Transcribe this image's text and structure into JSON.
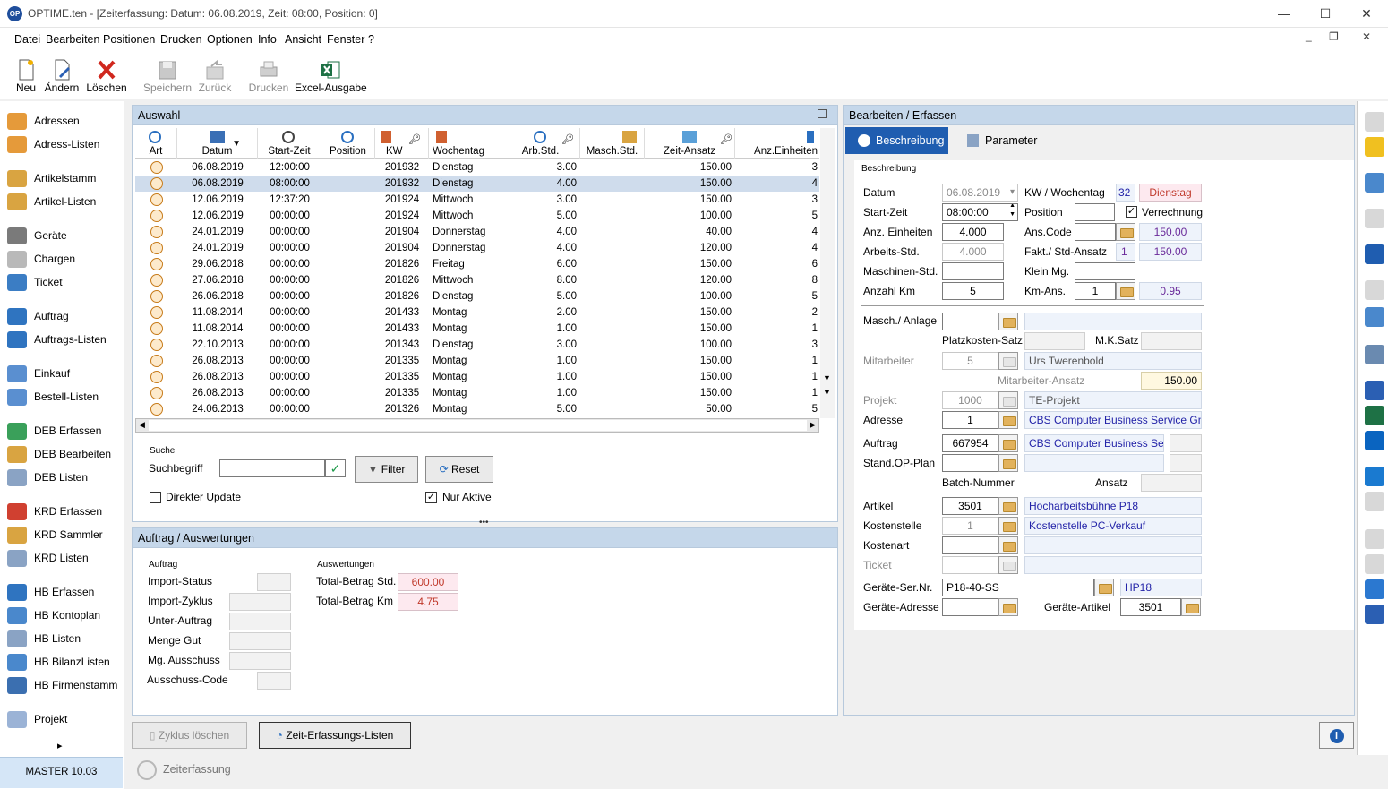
{
  "titlebar": {
    "app": "OPTIME.ten",
    "title": "- [Zeiterfassung: Datum: 06.08.2019, Zeit: 08:00, Position: 0]",
    "logo": "OP",
    "minimize_icon": "—",
    "maximize_icon": "☐",
    "close_icon": "✕",
    "mdi_minimize": "_",
    "mdi_restore": "❐",
    "mdi_close": "✕"
  },
  "menu": [
    "Datei",
    "Bearbeiten",
    "Positionen",
    "Drucken",
    "Optionen",
    "Info",
    "Ansicht",
    "Fenster",
    "?"
  ],
  "toolbar": {
    "new": "Neu",
    "edit": "Ändern",
    "delete": "Löschen",
    "save": "Speichern",
    "back": "Zurück",
    "print": "Drucken",
    "excel": "Excel-Ausgabe"
  },
  "sidebar": {
    "items": [
      "Adressen",
      "Adress-Listen",
      "Artikelstamm",
      "Artikel-Listen",
      "Geräte",
      "Chargen",
      "Ticket",
      "Auftrag",
      "Auftrags-Listen",
      "Einkauf",
      "Bestell-Listen",
      "DEB Erfassen",
      "DEB Bearbeiten",
      "DEB Listen",
      "KRD Erfassen",
      "KRD Sammler",
      "KRD Listen",
      "HB Erfassen",
      "HB Kontoplan",
      "HB Listen",
      "HB BilanzListen",
      "HB Firmenstamm",
      "Projekt"
    ],
    "expand_arrow": "▸",
    "master": "MASTER   10.03"
  },
  "auswahl": {
    "title": "Auswahl",
    "columns": [
      "Art",
      "Datum",
      "Start-Zeit",
      "Position",
      "KW",
      "Wochentag",
      "Arb.Std.",
      "Masch.Std.",
      "Zeit-Ansatz",
      "Anz.Einheiten"
    ],
    "rows": [
      {
        "datum": "06.08.2019",
        "start": "12:00:00",
        "pos": "",
        "kw": "201932",
        "tag": "Dienstag",
        "arb": "3.00",
        "masch": "",
        "ansatz": "150.00",
        "anz": "3"
      },
      {
        "datum": "06.08.2019",
        "start": "08:00:00",
        "pos": "",
        "kw": "201932",
        "tag": "Dienstag",
        "arb": "4.00",
        "masch": "",
        "ansatz": "150.00",
        "anz": "4"
      },
      {
        "datum": "12.06.2019",
        "start": "12:37:20",
        "pos": "",
        "kw": "201924",
        "tag": "Mittwoch",
        "arb": "3.00",
        "masch": "",
        "ansatz": "150.00",
        "anz": "3"
      },
      {
        "datum": "12.06.2019",
        "start": "00:00:00",
        "pos": "",
        "kw": "201924",
        "tag": "Mittwoch",
        "arb": "5.00",
        "masch": "",
        "ansatz": "100.00",
        "anz": "5"
      },
      {
        "datum": "24.01.2019",
        "start": "00:00:00",
        "pos": "",
        "kw": "201904",
        "tag": "Donnerstag",
        "arb": "4.00",
        "masch": "",
        "ansatz": "40.00",
        "anz": "4"
      },
      {
        "datum": "24.01.2019",
        "start": "00:00:00",
        "pos": "",
        "kw": "201904",
        "tag": "Donnerstag",
        "arb": "4.00",
        "masch": "",
        "ansatz": "120.00",
        "anz": "4"
      },
      {
        "datum": "29.06.2018",
        "start": "00:00:00",
        "pos": "",
        "kw": "201826",
        "tag": "Freitag",
        "arb": "6.00",
        "masch": "",
        "ansatz": "150.00",
        "anz": "6"
      },
      {
        "datum": "27.06.2018",
        "start": "00:00:00",
        "pos": "",
        "kw": "201826",
        "tag": "Mittwoch",
        "arb": "8.00",
        "masch": "",
        "ansatz": "120.00",
        "anz": "8"
      },
      {
        "datum": "26.06.2018",
        "start": "00:00:00",
        "pos": "",
        "kw": "201826",
        "tag": "Dienstag",
        "arb": "5.00",
        "masch": "",
        "ansatz": "100.00",
        "anz": "5"
      },
      {
        "datum": "11.08.2014",
        "start": "00:00:00",
        "pos": "",
        "kw": "201433",
        "tag": "Montag",
        "arb": "2.00",
        "masch": "",
        "ansatz": "150.00",
        "anz": "2"
      },
      {
        "datum": "11.08.2014",
        "start": "00:00:00",
        "pos": "",
        "kw": "201433",
        "tag": "Montag",
        "arb": "1.00",
        "masch": "",
        "ansatz": "150.00",
        "anz": "1"
      },
      {
        "datum": "22.10.2013",
        "start": "00:00:00",
        "pos": "",
        "kw": "201343",
        "tag": "Dienstag",
        "arb": "3.00",
        "masch": "",
        "ansatz": "100.00",
        "anz": "3"
      },
      {
        "datum": "26.08.2013",
        "start": "00:00:00",
        "pos": "",
        "kw": "201335",
        "tag": "Montag",
        "arb": "1.00",
        "masch": "",
        "ansatz": "150.00",
        "anz": "1"
      },
      {
        "datum": "26.08.2013",
        "start": "00:00:00",
        "pos": "",
        "kw": "201335",
        "tag": "Montag",
        "arb": "1.00",
        "masch": "",
        "ansatz": "150.00",
        "anz": "1"
      },
      {
        "datum": "26.08.2013",
        "start": "00:00:00",
        "pos": "",
        "kw": "201335",
        "tag": "Montag",
        "arb": "1.00",
        "masch": "",
        "ansatz": "150.00",
        "anz": "1"
      },
      {
        "datum": "24.06.2013",
        "start": "00:00:00",
        "pos": "",
        "kw": "201326",
        "tag": "Montag",
        "arb": "5.00",
        "masch": "",
        "ansatz": "50.00",
        "anz": "5"
      }
    ],
    "selected_row": 1,
    "search": {
      "group": "Suche",
      "label": "Suchbegriff",
      "value": "",
      "filter": "Filter",
      "reset": "Reset",
      "direct_update": "Direkter Update",
      "only_active": "Nur Aktive",
      "only_active_checked": true,
      "direct_update_checked": false
    },
    "checkmark": "✓",
    "scroll_left": "◀",
    "scroll_right": "▶",
    "scroll_up": "▲",
    "scroll_down": "▼"
  },
  "auftrag_panel": {
    "title": "Auftrag / Auswertungen",
    "auftrag_group": "Auftrag",
    "labels": [
      "Import-Status",
      "Import-Zyklus",
      "Unter-Auftrag",
      "Menge Gut",
      "Mg. Ausschuss",
      "Ausschuss-Code"
    ],
    "auswertungen_group": "Auswertungen",
    "total_std_label": "Total-Betrag Std.",
    "total_std": "600.00",
    "total_km_label": "Total-Betrag Km",
    "total_km": "4.75"
  },
  "bottom": {
    "zyklus": "Zyklus löschen",
    "listen": "Zeit-Erfassungs-Listen",
    "status": "Zeiterfassung",
    "info_icon": "i"
  },
  "bearbeiten": {
    "title": "Bearbeiten / Erfassen",
    "tab_beschreibung": "Beschreibung",
    "tab_parameter": "Parameter",
    "group": "Beschreibung",
    "datum_label": "Datum",
    "datum": "06.08.2019",
    "kw_label": "KW / Wochentag",
    "kw": "32",
    "wochentag": "Dienstag",
    "start_label": "Start-Zeit",
    "start": "08:00:00",
    "position_label": "Position",
    "position": "",
    "verrechnung_label": "Verrechnung",
    "verrechnung_checked": true,
    "anz_label": "Anz. Einheiten",
    "anz": "4.000",
    "anscode_label": "Ans.Code",
    "anscode": "",
    "anscode_val": "150.00",
    "arbeit_label": "Arbeits-Std.",
    "arbeit": "4.000",
    "fakt_label": "Fakt./ Std-Ansatz",
    "fakt": "1",
    "fakt_val": "150.00",
    "masch_label": "Maschinen-Std.",
    "masch": "",
    "kleinmg_label": "Klein Mg.",
    "kleinmg": "",
    "km_label": "Anzahl Km",
    "km": "5",
    "kmans_label": "Km-Ans.",
    "kmans": "1",
    "kmans_val": "0.95",
    "anlage_label": "Masch./ Anlage",
    "anlage": "",
    "anlage_name": "",
    "platz_label": "Platzkosten-Satz",
    "platz": "",
    "mksatz_label": "M.K.Satz",
    "mksatz": "",
    "mitarbeiter_label": "Mitarbeiter",
    "mitarbeiter": "5",
    "mitarbeiter_name": "Urs Twerenbold",
    "ma_ansatz_label": "Mitarbeiter-Ansatz",
    "ma_ansatz": "150.00",
    "projekt_label": "Projekt",
    "projekt": "1000",
    "projekt_name": "TE-Projekt",
    "adresse_label": "Adresse",
    "adresse": "1",
    "adresse_name": "CBS Computer Business Service GmbH",
    "auftrag_label": "Auftrag",
    "auftrag": "667954",
    "auftrag_name": "CBS Computer Business Service",
    "standop_label": "Stand.OP-Plan",
    "standop": "",
    "batch_label": "Batch-Nummer",
    "ansatz_label": "Ansatz",
    "ansatz": "",
    "artikel_label": "Artikel",
    "artikel": "3501",
    "artikel_name": "Hocharbeitsbühne P18",
    "kst_label": "Kostenstelle",
    "kst": "1",
    "kst_name": "Kostenstelle PC-Verkauf",
    "kostenart_label": "Kostenart",
    "kostenart": "",
    "kostenart_name": "",
    "ticket_label": "Ticket",
    "ticket": "",
    "ticket_name": "",
    "serial_label": "Geräte-Ser.Nr.",
    "serial": "P18-40-SS",
    "serial_name": "HP18",
    "geradr_label": "Geräte-Adresse",
    "geradr": "",
    "gerart_label": "Geräte-Artikel",
    "gerart": "3501",
    "spin_up": "▲",
    "spin_down": "▼",
    "dropdown": "▾"
  },
  "colors": {
    "panel_header": "#c5d7ea",
    "selected_row": "#cfdcec",
    "tab_active": "#1f5db0",
    "accent_orange": "#e2b25c"
  }
}
